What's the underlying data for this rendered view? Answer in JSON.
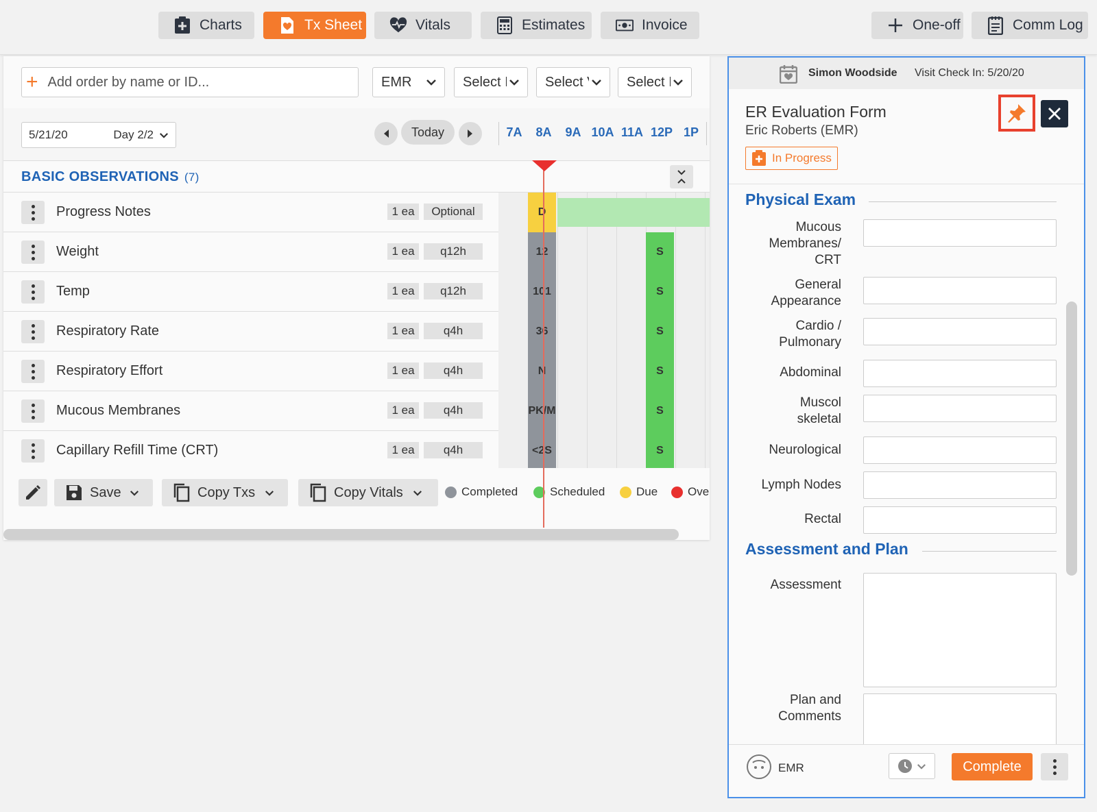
{
  "topbar": {
    "tabs": [
      {
        "label": "Charts",
        "icon": "clipboard-plus-icon"
      },
      {
        "label": "Tx Sheet",
        "icon": "heart-doc-icon",
        "active": true
      },
      {
        "label": "Vitals",
        "icon": "heart-pulse-icon"
      },
      {
        "label": "Estimates",
        "icon": "calculator-icon"
      },
      {
        "label": "Invoice",
        "icon": "money-icon"
      }
    ],
    "right": [
      {
        "label": "One-off",
        "icon": "plus-icon"
      },
      {
        "label": "Comm Log",
        "icon": "notepad-icon"
      }
    ]
  },
  "orders": {
    "add_placeholder": "Add order by name or ID...",
    "filters": [
      "EMR",
      "Select I",
      "Select V",
      "Select I"
    ]
  },
  "timeline": {
    "date": "5/21/20",
    "day": "Day 2/2",
    "today_label": "Today",
    "hours": [
      "7A",
      "8A",
      "9A",
      "10A",
      "11A",
      "12P",
      "1P"
    ]
  },
  "section": {
    "title": "BASIC OBSERVATIONS",
    "count": "(7)"
  },
  "rows": [
    {
      "name": "Progress Notes",
      "qty": "1 ea",
      "freq": "Optional",
      "current": "D",
      "current_status": "due",
      "scheduled": ""
    },
    {
      "name": "Weight",
      "qty": "1 ea",
      "freq": "q12h",
      "current": "12",
      "current_status": "completed",
      "scheduled": "S"
    },
    {
      "name": "Temp",
      "qty": "1 ea",
      "freq": "q12h",
      "current": "101",
      "current_status": "completed",
      "scheduled": "S"
    },
    {
      "name": "Respiratory Rate",
      "qty": "1 ea",
      "freq": "q4h",
      "current": "36",
      "current_status": "completed",
      "scheduled": "S"
    },
    {
      "name": "Respiratory Effort",
      "qty": "1 ea",
      "freq": "q4h",
      "current": "N",
      "current_status": "completed",
      "scheduled": "S"
    },
    {
      "name": "Mucous Membranes",
      "qty": "1 ea",
      "freq": "q4h",
      "current": "PK/M",
      "current_status": "completed",
      "scheduled": "S"
    },
    {
      "name": "Capillary Refill Time (CRT)",
      "qty": "1 ea",
      "freq": "q4h",
      "current": "<2S",
      "current_status": "completed",
      "scheduled": "S"
    }
  ],
  "bottom": {
    "save": "Save",
    "copy_txs": "Copy Txs",
    "copy_vitals": "Copy Vitals",
    "legend": [
      {
        "label": "Completed",
        "color": "#8f949b"
      },
      {
        "label": "Scheduled",
        "color": "#5dcc5d"
      },
      {
        "label": "Due",
        "color": "#f7d040"
      },
      {
        "label": "Over",
        "color": "#e8302e"
      }
    ]
  },
  "panel": {
    "patient": "Simon Woodside",
    "visit": "Visit Check In: 5/20/20",
    "form_title": "ER Evaluation Form",
    "author": "Eric Roberts (EMR)",
    "status": "In Progress",
    "physical_exam_title": "Physical Exam",
    "physical_exam_fields": [
      "Mucous Membranes/ CRT",
      "General Appearance",
      "Cardio / Pulmonary",
      "Abdominal",
      "Muscol skeletal",
      "Neurological",
      "Lymph Nodes",
      "Rectal"
    ],
    "assessment_title": "Assessment and Plan",
    "assessment_label": "Assessment",
    "plan_label": "Plan and Comments",
    "footer_user": "EMR",
    "complete_label": "Complete"
  },
  "colors": {
    "accent": "#f47a2c",
    "link_blue": "#1f63b5",
    "completed": "#8f949b",
    "scheduled": "#5dcc5d",
    "due": "#f7d040",
    "progress_bar": "#b2e8b2"
  }
}
